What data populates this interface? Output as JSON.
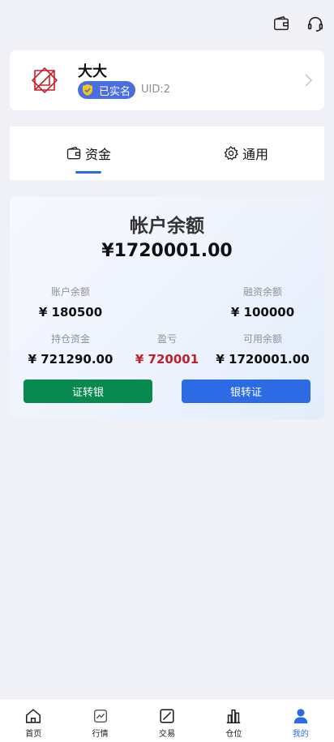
{
  "topbar": {
    "icons": [
      "wallet-icon",
      "headset-icon"
    ]
  },
  "profile": {
    "name": "大大",
    "verified_label": "已实名",
    "uid": "UID:2"
  },
  "tabs": [
    {
      "label": "资金",
      "icon": "wallet-icon",
      "active": true
    },
    {
      "label": "通用",
      "icon": "gear-icon",
      "active": false
    }
  ],
  "balance": {
    "title": "帐户余额",
    "total": "¥1720001.00",
    "account_balance": {
      "label": "账户余额",
      "value": "¥ 180500"
    },
    "financing_balance": {
      "label": "融资余额",
      "value": "¥ 100000"
    },
    "position_funds": {
      "label": "持仓资金",
      "value": "¥ 721290.00"
    },
    "profit_loss": {
      "label": "盈亏",
      "value": "¥ 720001"
    },
    "available_balance": {
      "label": "可用余额",
      "value": "¥ 1720001.00"
    },
    "transfer_to_bank": "证转银",
    "transfer_from_bank": "银转证"
  },
  "colors": {
    "accent": "#2c6be3",
    "green_button": "#07894f",
    "profit_red": "#c0202a",
    "verified_badge": "#4a6ee0"
  },
  "nav": [
    {
      "label": "首页",
      "icon": "home-icon",
      "active": false
    },
    {
      "label": "行情",
      "icon": "market-icon",
      "active": false
    },
    {
      "label": "交易",
      "icon": "trade-icon",
      "active": false
    },
    {
      "label": "仓位",
      "icon": "position-icon",
      "active": false
    },
    {
      "label": "我的",
      "icon": "user-icon",
      "active": true
    }
  ]
}
